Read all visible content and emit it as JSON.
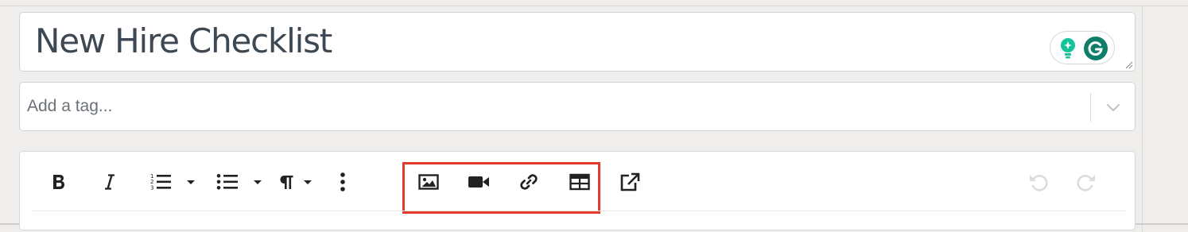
{
  "page": {
    "title_value": "New Hire Checklist"
  },
  "tags": {
    "placeholder": "Add a tag..."
  },
  "toolbar": {
    "items": [
      {
        "icon": "bold-icon",
        "glyph": "B"
      },
      {
        "icon": "italic-icon",
        "glyph": "I"
      },
      {
        "icon": "ordered-list-icon"
      },
      {
        "icon": "caret-down-icon"
      },
      {
        "icon": "unordered-list-icon"
      },
      {
        "icon": "caret-down-icon"
      },
      {
        "icon": "paragraph-icon",
        "glyph": "¶"
      },
      {
        "icon": "more-vertical-icon"
      },
      {
        "icon": "image-icon"
      },
      {
        "icon": "video-icon"
      },
      {
        "icon": "link-icon"
      },
      {
        "icon": "table-icon"
      },
      {
        "icon": "external-link-icon"
      },
      {
        "icon": "undo-icon"
      },
      {
        "icon": "redo-icon"
      }
    ],
    "highlight_color": "#e23b2c"
  },
  "colors": {
    "text": "#3d4852",
    "grammarly_green": "#15c39a",
    "grammarly_dark": "#0e7e68"
  }
}
